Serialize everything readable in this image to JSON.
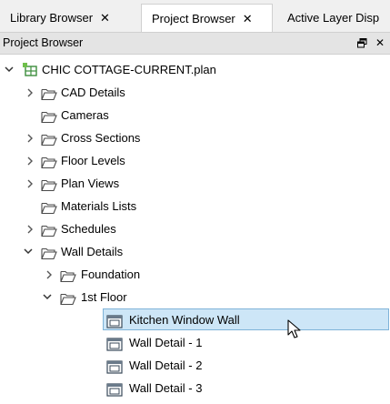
{
  "tabs": [
    {
      "label": "Library Browser",
      "close": "✕",
      "active": false
    },
    {
      "label": "Project Browser",
      "close": "✕",
      "active": true
    },
    {
      "label": "Active Layer Disp",
      "close": "",
      "active": false
    }
  ],
  "panel": {
    "title": "Project Browser",
    "pin_glyph": "🗗",
    "close_glyph": "✕"
  },
  "tree": {
    "root": "CHIC COTTAGE-CURRENT.plan",
    "items": [
      "CAD Details",
      "Cameras",
      "Cross Sections",
      "Floor Levels",
      "Plan Views",
      "Materials Lists",
      "Schedules",
      "Wall Details",
      "Foundation",
      "1st Floor",
      "Kitchen Window Wall",
      "Wall Detail - 1",
      "Wall Detail - 2",
      "Wall Detail - 3"
    ]
  },
  "colors": {
    "folder": "#4a4a4a",
    "selection": "#cde6f7",
    "selection_border": "#7fb3d8",
    "plan_icon": "#3c8d3c"
  }
}
